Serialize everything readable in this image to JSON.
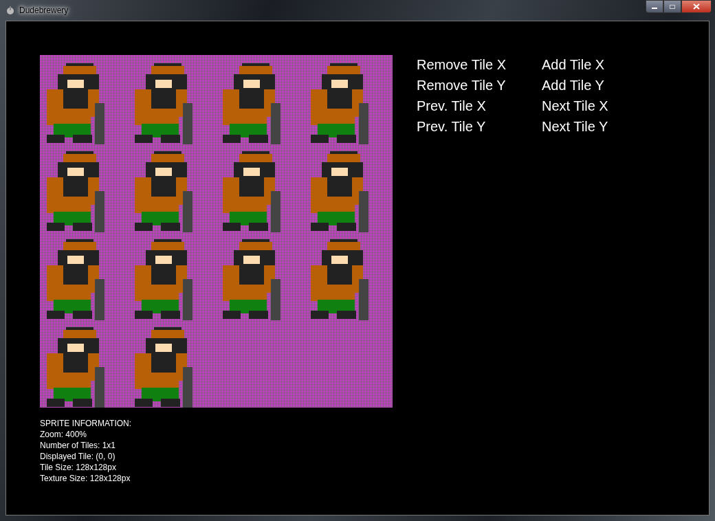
{
  "window": {
    "title": "Dudebrewery"
  },
  "button_rows": [
    {
      "left": "Remove Tile X",
      "right": "Add Tile X"
    },
    {
      "left": "Remove Tile Y",
      "right": "Add Tile Y"
    },
    {
      "left": "Prev. Tile X",
      "right": "Next Tile X"
    },
    {
      "left": "Prev. Tile Y",
      "right": "Next Tile Y"
    }
  ],
  "sprite_info": [
    "SPRITE INFORMATION:",
    "Zoom: 400%",
    "Number of Tiles: 1x1",
    "Displayed Tile: (0, 0)",
    "Tile Size: 128x128px",
    "Texture Size: 128x128px"
  ]
}
